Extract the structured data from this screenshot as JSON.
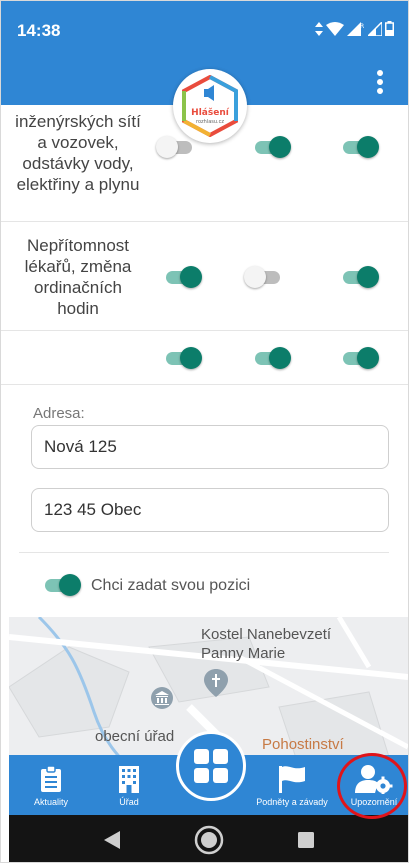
{
  "status_bar": {
    "time": "14:38"
  },
  "app": {
    "logo_title": "Hlášení",
    "logo_subtitle": "rozhlasu.cz",
    "colors": {
      "primary": "#2f86d4",
      "toggle_on": "#0c7d6a",
      "highlight": "#e0141a"
    }
  },
  "notification_rows": [
    {
      "label": "inženýrských sítí a vozovek, odstávky vody, elektřiny a plynu",
      "toggles": [
        false,
        true,
        true
      ]
    },
    {
      "label": "Nepřítomnost lékařů, změna ordinačních hodin",
      "toggles": [
        true,
        false,
        true
      ]
    },
    {
      "label": "",
      "toggles": [
        true,
        true,
        true
      ]
    }
  ],
  "address": {
    "label": "Adresa:",
    "street": "Nová 125",
    "city": "123 45 Obec"
  },
  "position": {
    "label": "Chci zadat svou pozici",
    "enabled": true
  },
  "map": {
    "labels": [
      "Kostel Nanebevzetí Panny Marie",
      "obecní úřad",
      "Pohostinství"
    ]
  },
  "bottom_nav": {
    "items": [
      {
        "label": "Aktuality",
        "icon": "news-icon"
      },
      {
        "label": "Úřad",
        "icon": "building-icon"
      },
      {
        "label": "",
        "icon": "grid-icon"
      },
      {
        "label": "Podněty a závady",
        "icon": "flag-icon"
      },
      {
        "label": "Upozornění",
        "icon": "user-settings-icon",
        "active": true
      }
    ]
  },
  "system_nav": {
    "back": "back-icon",
    "home": "home-icon",
    "recents": "recents-icon"
  }
}
